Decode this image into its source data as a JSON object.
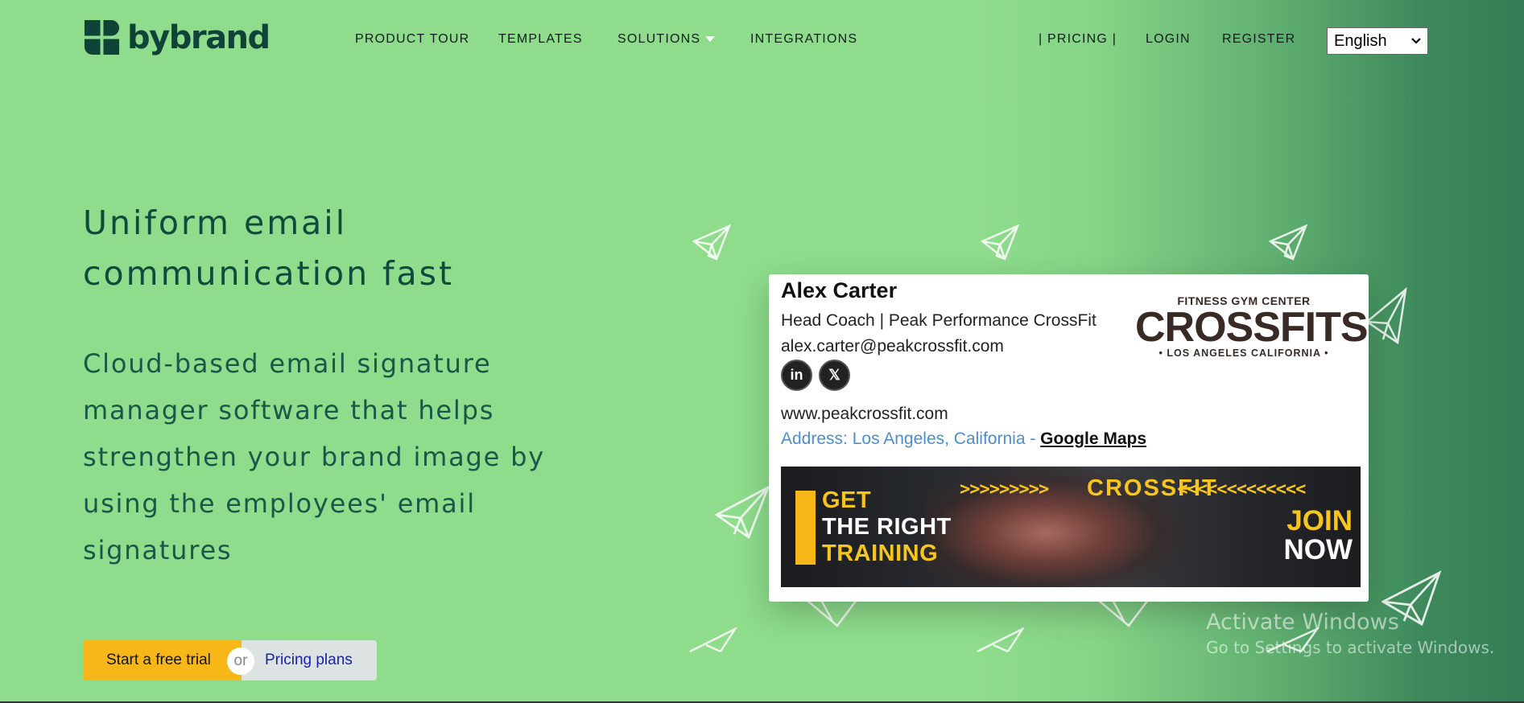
{
  "brand": {
    "name": "bybrand"
  },
  "nav": {
    "product_tour": "PRODUCT TOUR",
    "templates": "TEMPLATES",
    "solutions": "SOLUTIONS",
    "integrations": "INTEGRATIONS",
    "pricing": "| PRICING |",
    "login": "LOGIN",
    "register": "REGISTER"
  },
  "language": {
    "selected": "English"
  },
  "hero": {
    "title": "Uniform email communication fast",
    "subtitle": "Cloud-based email signature manager software that helps strengthen your brand image by using the employees' email signatures"
  },
  "cta": {
    "trial_label": "Start a free trial",
    "or_label": "or",
    "pricing_label": "Pricing plans"
  },
  "signature": {
    "name": "Alex Carter",
    "role": "Head Coach | Peak Performance CrossFit",
    "email": "alex.carter@peakcrossfit.com",
    "social": [
      "linkedin-icon",
      "x-icon"
    ],
    "linkedin_glyph": "in",
    "x_glyph": "𝕏",
    "website": "www.peakcrossfit.com",
    "address_prefix": "Address: Los Angeles, California - ",
    "maps_link": "Google Maps",
    "logo": {
      "top": "FITNESS GYM CENTER",
      "main": "CROSSFITS",
      "bottom": "• LOS ANGELES CALIFORNIA •"
    },
    "banner": {
      "get": "GET",
      "the_right": "THE RIGHT",
      "training": "TRAINING",
      "arrows_left": ">>>>>>>>>",
      "crossfit": "CROSSFIT",
      "arrows_right": "<<<<<<<<<<<<<",
      "join": "JOIN",
      "now": "NOW"
    }
  },
  "watermark": {
    "title": "Activate Windows",
    "subtitle": "Go to Settings to activate Windows."
  },
  "colors": {
    "background": "#8edc8c",
    "accent_dark": "#337d54",
    "cta_yellow": "#f7b719",
    "pricing_blue": "#1a22a8",
    "logo_green": "#104338"
  }
}
